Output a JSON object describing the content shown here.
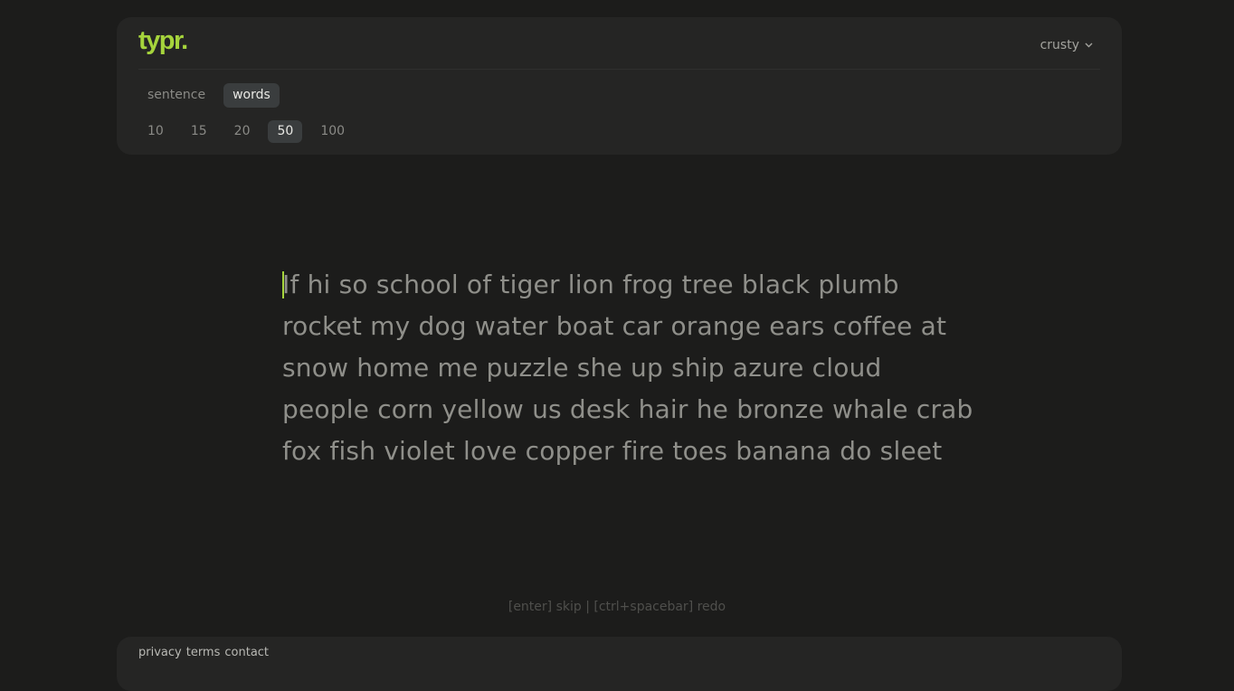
{
  "header": {
    "logo": "typr.",
    "theme": {
      "label": "crusty",
      "icon": "chevron-down-icon"
    },
    "modes": [
      {
        "label": "sentence",
        "active": false
      },
      {
        "label": "words",
        "active": true
      }
    ],
    "word_counts": [
      {
        "label": "10",
        "active": false
      },
      {
        "label": "15",
        "active": false
      },
      {
        "label": "20",
        "active": false
      },
      {
        "label": "50",
        "active": true
      },
      {
        "label": "100",
        "active": false
      }
    ]
  },
  "typing": {
    "lines": [
      "If hi so school of tiger lion frog tree black plumb",
      "rocket my dog water boat car orange ears coffee at",
      "snow home me puzzle she up ship azure cloud",
      "people corn yellow us desk hair he bronze whale crab",
      "fox fish violet love copper fire toes banana do sleet"
    ]
  },
  "hint": "[enter] skip | [ctrl+spacebar] redo",
  "footer": {
    "links": [
      "privacy",
      "terms",
      "contact"
    ]
  },
  "colors": {
    "accent": "#a6d43c",
    "background": "#1c1c1b",
    "panel": "#252524",
    "text": "#8f8f8a"
  }
}
